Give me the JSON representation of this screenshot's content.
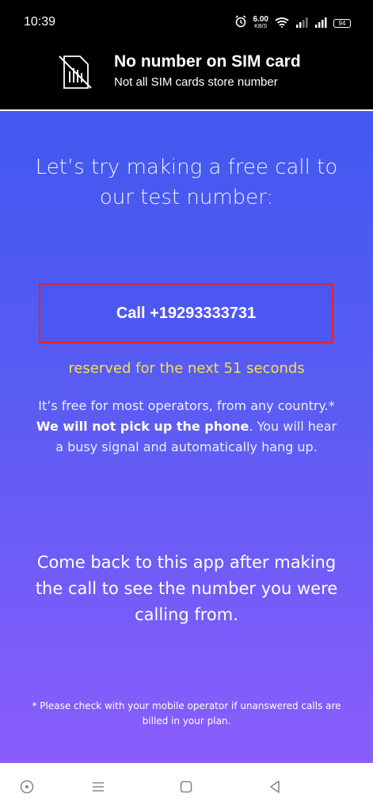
{
  "status_bar": {
    "time": "10:39",
    "net_speed_value": "6.00",
    "net_speed_unit": "KB/S",
    "battery": "94",
    "icons": [
      "alarm-icon",
      "wifi-icon",
      "signal-icon",
      "signal-icon",
      "battery-icon"
    ]
  },
  "banner": {
    "icon": "no-sim-icon",
    "title": "No number on SIM card",
    "subtitle": "Not all SIM cards store number"
  },
  "main": {
    "headline": "Let’s try making a free call to our test number:",
    "call_button_label": "Call +19293333731",
    "reserved_text": "reserved for the next 51 seconds",
    "free_line": "It’s free for most operators, from any country.*",
    "no_pickup_bold": "We will not pick up the phone",
    "no_pickup_rest": ". You will hear a busy signal and automatically hang up.",
    "come_back": "Come back to this app after making the call to see the number you were calling from.",
    "footnote": "* Please check with your mobile operator if unanswered calls are billed in your plan."
  },
  "colors": {
    "background_top": "#4158f0",
    "background_bottom": "#8a5dfc",
    "button_border": "#e0252e",
    "reserved_text": "#f4e24a"
  },
  "nav_bar": {
    "icons": [
      "assistant-icon",
      "menu-icon",
      "home-icon",
      "back-icon"
    ]
  }
}
